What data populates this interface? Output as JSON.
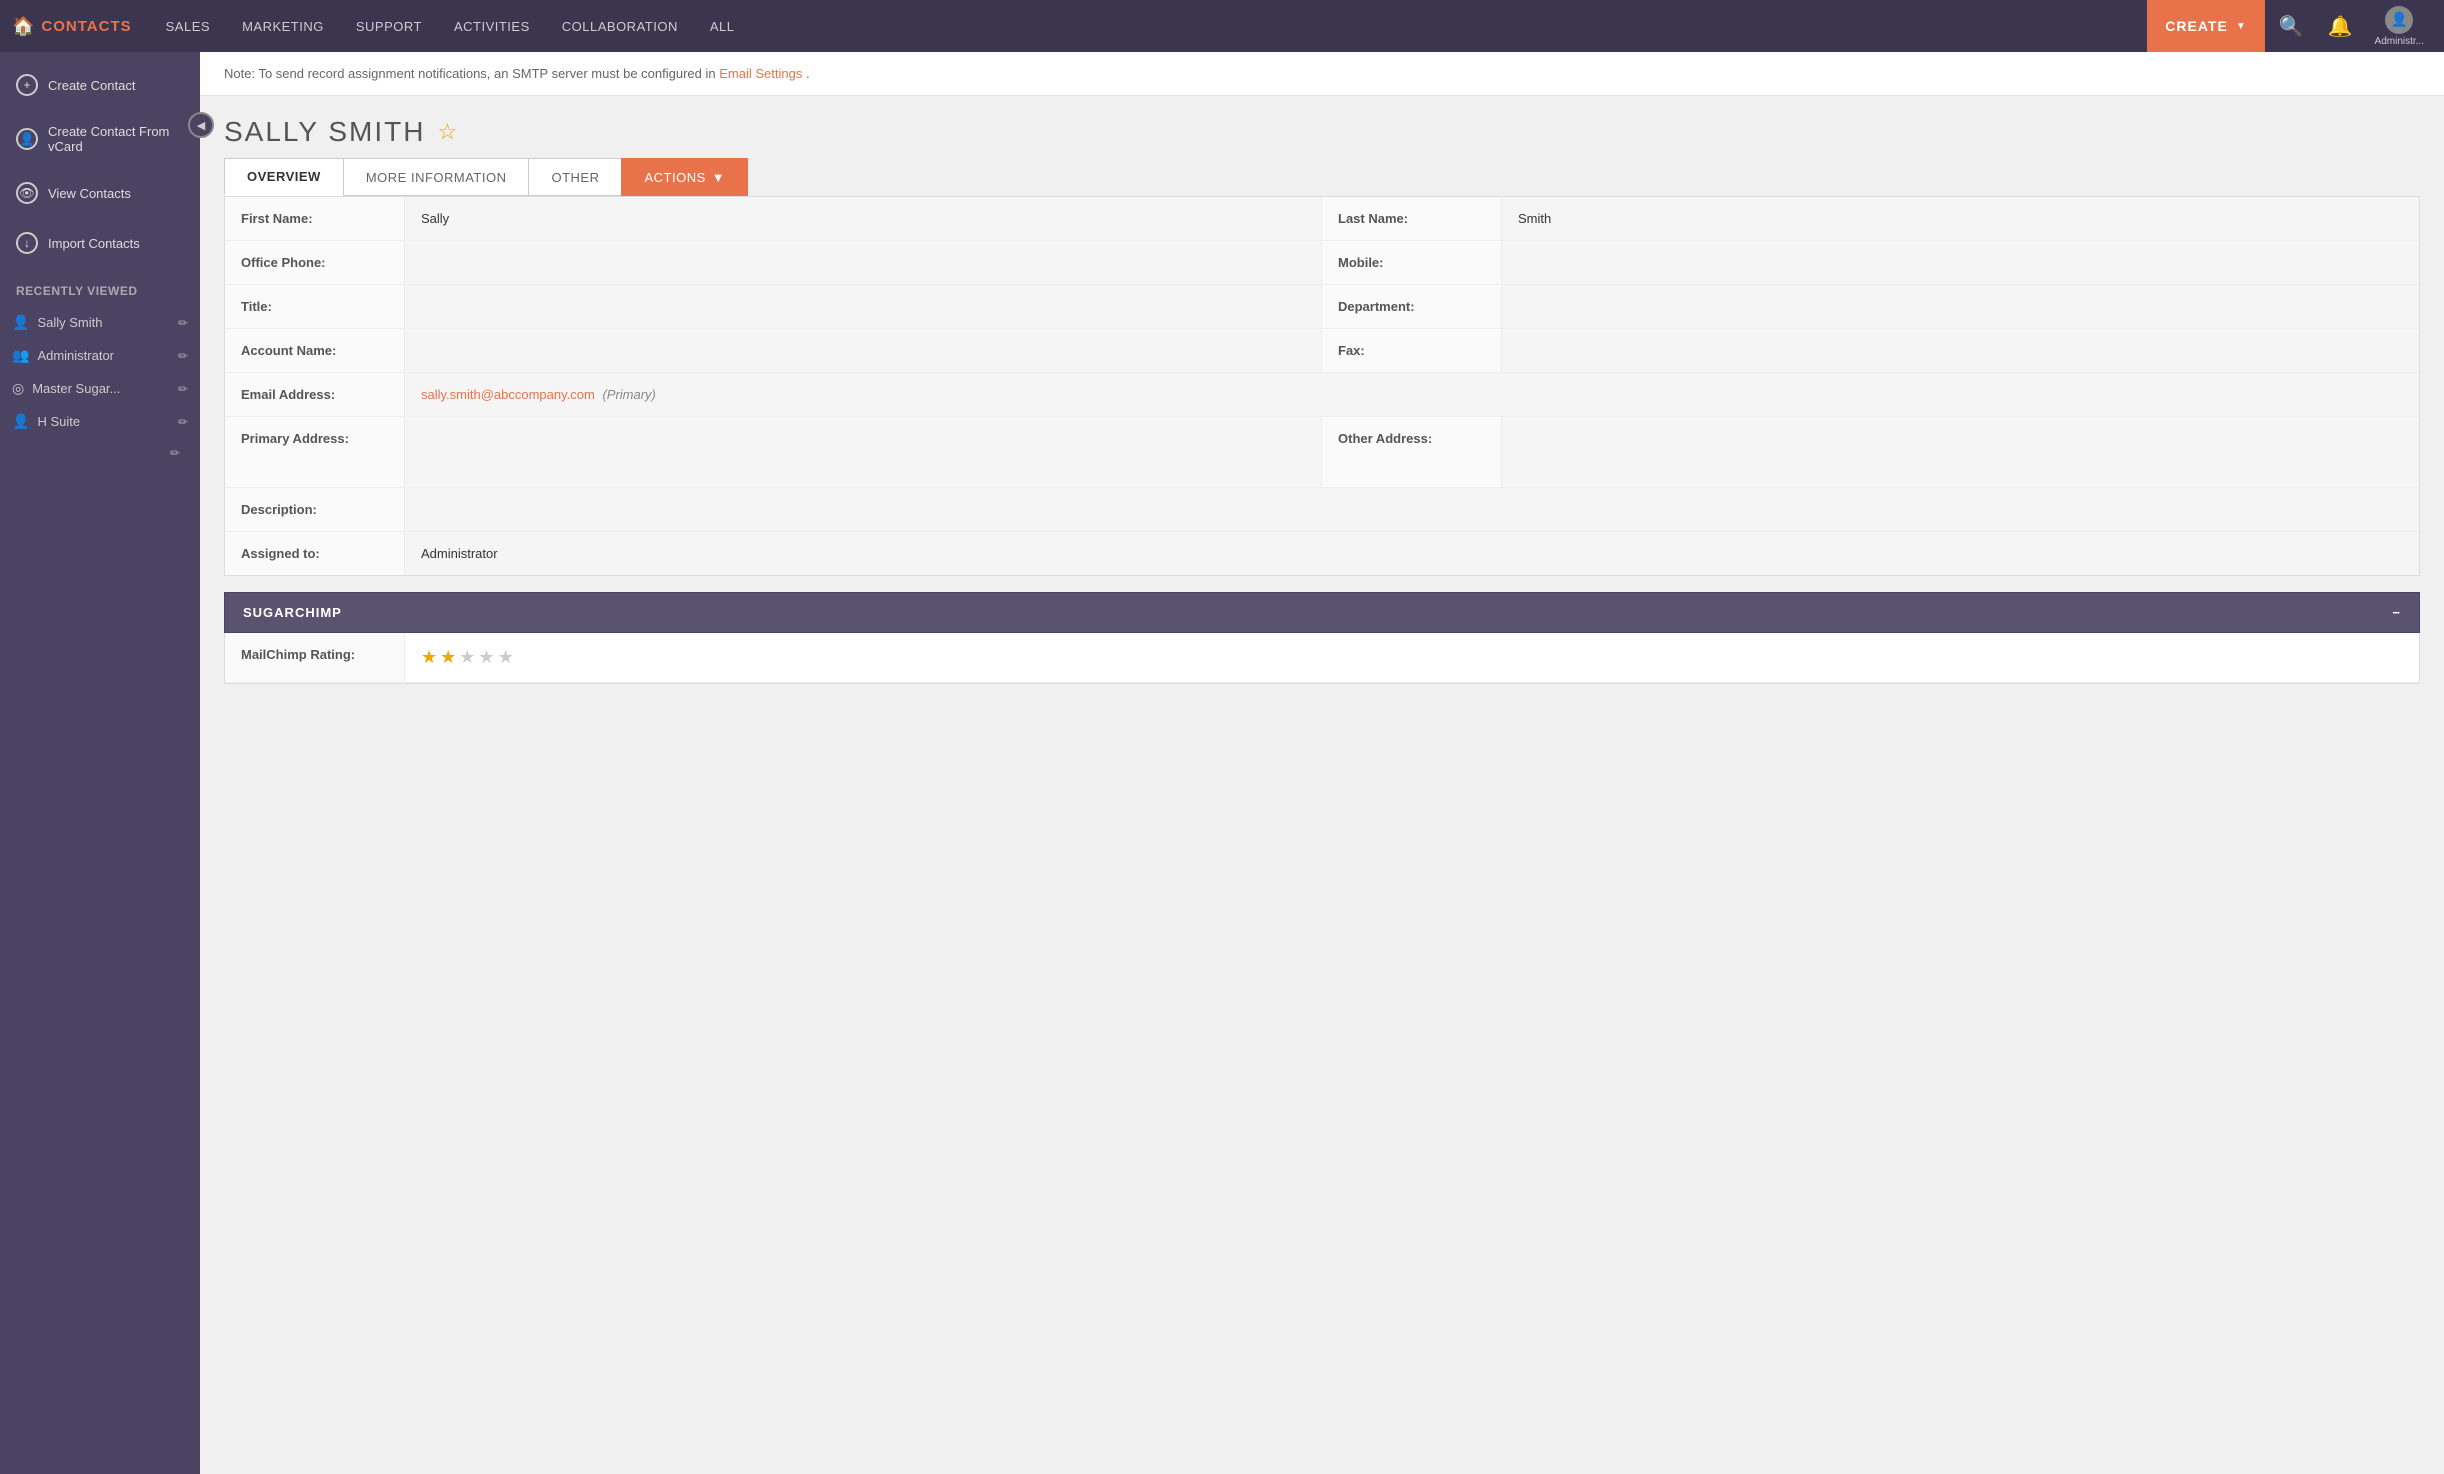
{
  "nav": {
    "brand": "CONTACTS",
    "home_icon": "🏠",
    "items": [
      {
        "label": "SALES",
        "active": false
      },
      {
        "label": "MARKETING",
        "active": false
      },
      {
        "label": "SUPPORT",
        "active": false
      },
      {
        "label": "ACTIVITIES",
        "active": false
      },
      {
        "label": "COLLABORATION",
        "active": false
      },
      {
        "label": "ALL",
        "active": false
      }
    ],
    "create_label": "CREATE",
    "admin_label": "Administr..."
  },
  "sidebar": {
    "items": [
      {
        "label": "Create Contact",
        "icon": "+"
      },
      {
        "label": "Create Contact From vCard",
        "icon": "👤"
      },
      {
        "label": "View Contacts",
        "icon": "👁"
      },
      {
        "label": "Import Contacts",
        "icon": "↓"
      }
    ],
    "recently_viewed_label": "Recently Viewed",
    "recent_items": [
      {
        "label": "Sally Smith",
        "icon": "👤"
      },
      {
        "label": "Administrator",
        "icon": "👥"
      },
      {
        "label": "Master Sugar...",
        "icon": "◎"
      },
      {
        "label": "H Suite",
        "icon": "👤"
      }
    ]
  },
  "contact": {
    "name": "SALLY SMITH",
    "star": "☆",
    "tabs": [
      {
        "label": "OVERVIEW",
        "active": true
      },
      {
        "label": "MORE INFORMATION",
        "active": false
      },
      {
        "label": "OTHER",
        "active": false
      },
      {
        "label": "ACTIONS",
        "active": false,
        "has_chevron": true
      }
    ],
    "fields": {
      "first_name_label": "First Name:",
      "first_name_value": "Sally",
      "last_name_label": "Last Name:",
      "last_name_value": "Smith",
      "office_phone_label": "Office Phone:",
      "office_phone_value": "",
      "mobile_label": "Mobile:",
      "mobile_value": "",
      "title_label": "Title:",
      "title_value": "",
      "department_label": "Department:",
      "department_value": "",
      "account_name_label": "Account Name:",
      "account_name_value": "",
      "fax_label": "Fax:",
      "fax_value": "",
      "email_label": "Email Address:",
      "email_value": "sally.smith@abccompany.com",
      "email_tag": "(Primary)",
      "primary_address_label": "Primary Address:",
      "primary_address_value": "",
      "other_address_label": "Other Address:",
      "other_address_value": "",
      "description_label": "Description:",
      "description_value": "",
      "assigned_to_label": "Assigned to:",
      "assigned_to_value": "Administrator"
    }
  },
  "note": {
    "text": "Note: To send record assignment notifications, an SMTP server must be configured in",
    "link_text": "Email Settings",
    "suffix": "."
  },
  "sugarchimp": {
    "section_label": "SUGARCHIMP",
    "collapse_icon": "−",
    "mailchimp_label": "MailChimp Rating:",
    "rating": 2,
    "max_rating": 5
  }
}
